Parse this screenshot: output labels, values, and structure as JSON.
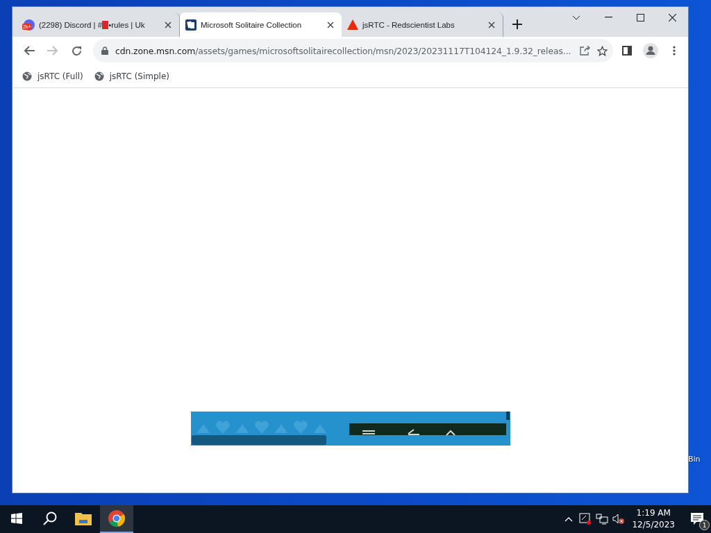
{
  "browser": {
    "tabs": [
      {
        "kind": "discord",
        "title_parts": [
          "(2298) Discord | #",
          "•rules | Uk"
        ],
        "badge": "2k+",
        "selected": false
      },
      {
        "kind": "cards",
        "title_parts": [
          "Microsoft Solitaire Collection"
        ],
        "selected": true
      },
      {
        "kind": "triangle",
        "title_parts": [
          "jsRTC - Redscientist Labs"
        ],
        "selected": false
      }
    ],
    "address": {
      "domain": "cdn.zone.msn.com",
      "path": "/assets/games/microsoftsolitairecollection/msn/2023/20231117T104124_1.9.32_releas..."
    },
    "bookmarks": [
      "jsRTC (Full)",
      "jsRTC (Simple)"
    ]
  },
  "desktop": {
    "icon_label": "Bin"
  },
  "taskbar": {
    "apps": [
      {
        "kind": "explorer",
        "selected": false
      },
      {
        "kind": "chrome",
        "selected": true
      }
    ],
    "time": "1:19 AM",
    "date": "12/5/2023",
    "notifications": "1"
  }
}
